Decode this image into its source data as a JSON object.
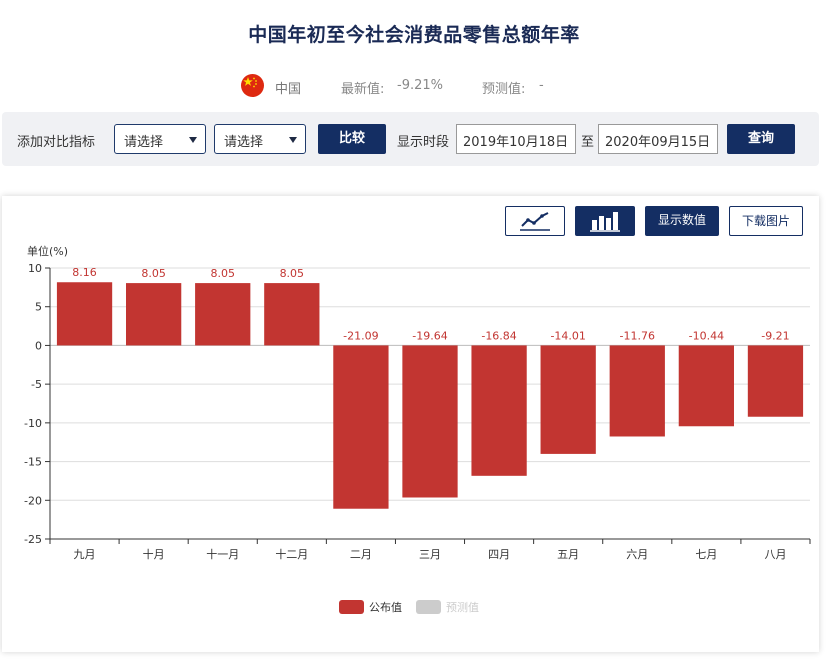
{
  "page": {
    "title": "中国年初至今社会消费品零售总额年率"
  },
  "info": {
    "country": "中国",
    "latest_label": "最新值:",
    "latest_value": "-9.21%",
    "forecast_label": "预测值:",
    "forecast_value": "-"
  },
  "controls": {
    "compare_label": "添加对比指标",
    "select1": "请选择",
    "select2": "请选择",
    "compare_button": "比较",
    "period_label": "显示时段",
    "start_date": "2019年10月18日",
    "to_label": "至",
    "end_date": "2020年09月15日",
    "query_button": "查询"
  },
  "toolbar": {
    "line_icon": "line-chart-icon",
    "bar_icon": "bar-chart-icon",
    "show_values": "显示数值",
    "download": "下载图片"
  },
  "colors": {
    "bar": "#c23531",
    "forecast": "#cccccc",
    "navy": "#142e63"
  },
  "chart_data": {
    "type": "bar",
    "unit_label": "单位(%)",
    "categories": [
      "九月",
      "十月",
      "十一月",
      "十二月",
      "二月",
      "三月",
      "四月",
      "五月",
      "六月",
      "七月",
      "八月"
    ],
    "series": [
      {
        "name": "公布值",
        "values": [
          8.16,
          8.05,
          8.05,
          8.05,
          -21.09,
          -19.64,
          -16.84,
          -14.01,
          -11.76,
          -10.44,
          -9.21
        ]
      }
    ],
    "legend": [
      "公布值",
      "预测值"
    ],
    "legend_position": "bottom-center",
    "ylim": [
      -25,
      10
    ],
    "yticks": [
      10,
      5,
      0,
      -5,
      -10,
      -15,
      -20,
      -25
    ],
    "grid": true,
    "data_labels": true
  }
}
